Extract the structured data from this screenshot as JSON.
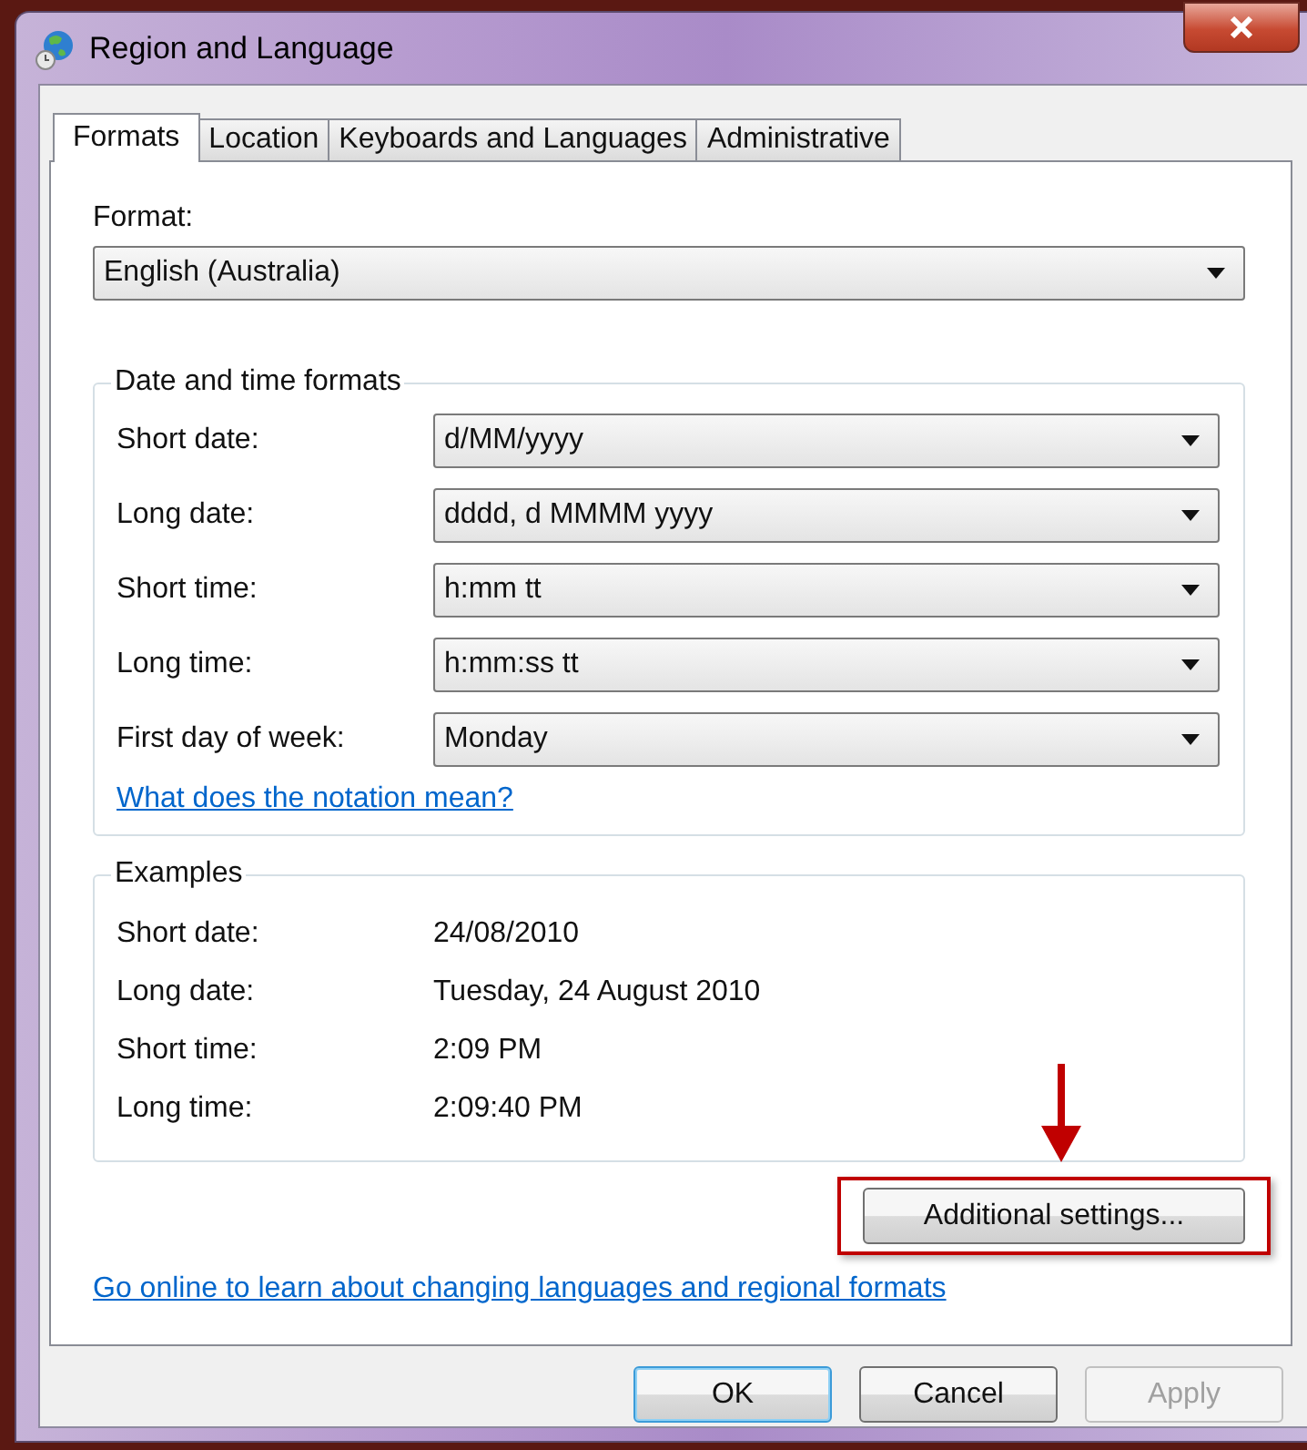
{
  "window": {
    "title": "Region and Language"
  },
  "tabs": [
    {
      "label": "Formats",
      "selected": true
    },
    {
      "label": "Location",
      "selected": false
    },
    {
      "label": "Keyboards and Languages",
      "selected": false
    },
    {
      "label": "Administrative",
      "selected": false
    }
  ],
  "format": {
    "label": "Format:",
    "value": "English (Australia)"
  },
  "date_time_formats": {
    "title": "Date and time formats",
    "rows": [
      {
        "label": "Short date:",
        "value": "d/MM/yyyy"
      },
      {
        "label": "Long date:",
        "value": "dddd, d MMMM yyyy"
      },
      {
        "label": "Short time:",
        "value": "h:mm tt"
      },
      {
        "label": "Long time:",
        "value": "h:mm:ss tt"
      },
      {
        "label": "First day of week:",
        "value": "Monday"
      }
    ],
    "link": "What does the notation mean?"
  },
  "examples": {
    "title": "Examples",
    "rows": [
      {
        "label": "Short date:",
        "value": "24/08/2010"
      },
      {
        "label": "Long date:",
        "value": "Tuesday, 24 August 2010"
      },
      {
        "label": "Short time:",
        "value": "2:09 PM"
      },
      {
        "label": "Long time:",
        "value": "2:09:40 PM"
      }
    ]
  },
  "additional_button": {
    "label": "Additional settings...",
    "annotated": true
  },
  "online_link": "Go online to learn about changing languages and regional formats",
  "buttons": [
    {
      "label": "OK",
      "default": true,
      "disabled": false
    },
    {
      "label": "Cancel",
      "default": false,
      "disabled": false
    },
    {
      "label": "Apply",
      "default": false,
      "disabled": true
    }
  ]
}
